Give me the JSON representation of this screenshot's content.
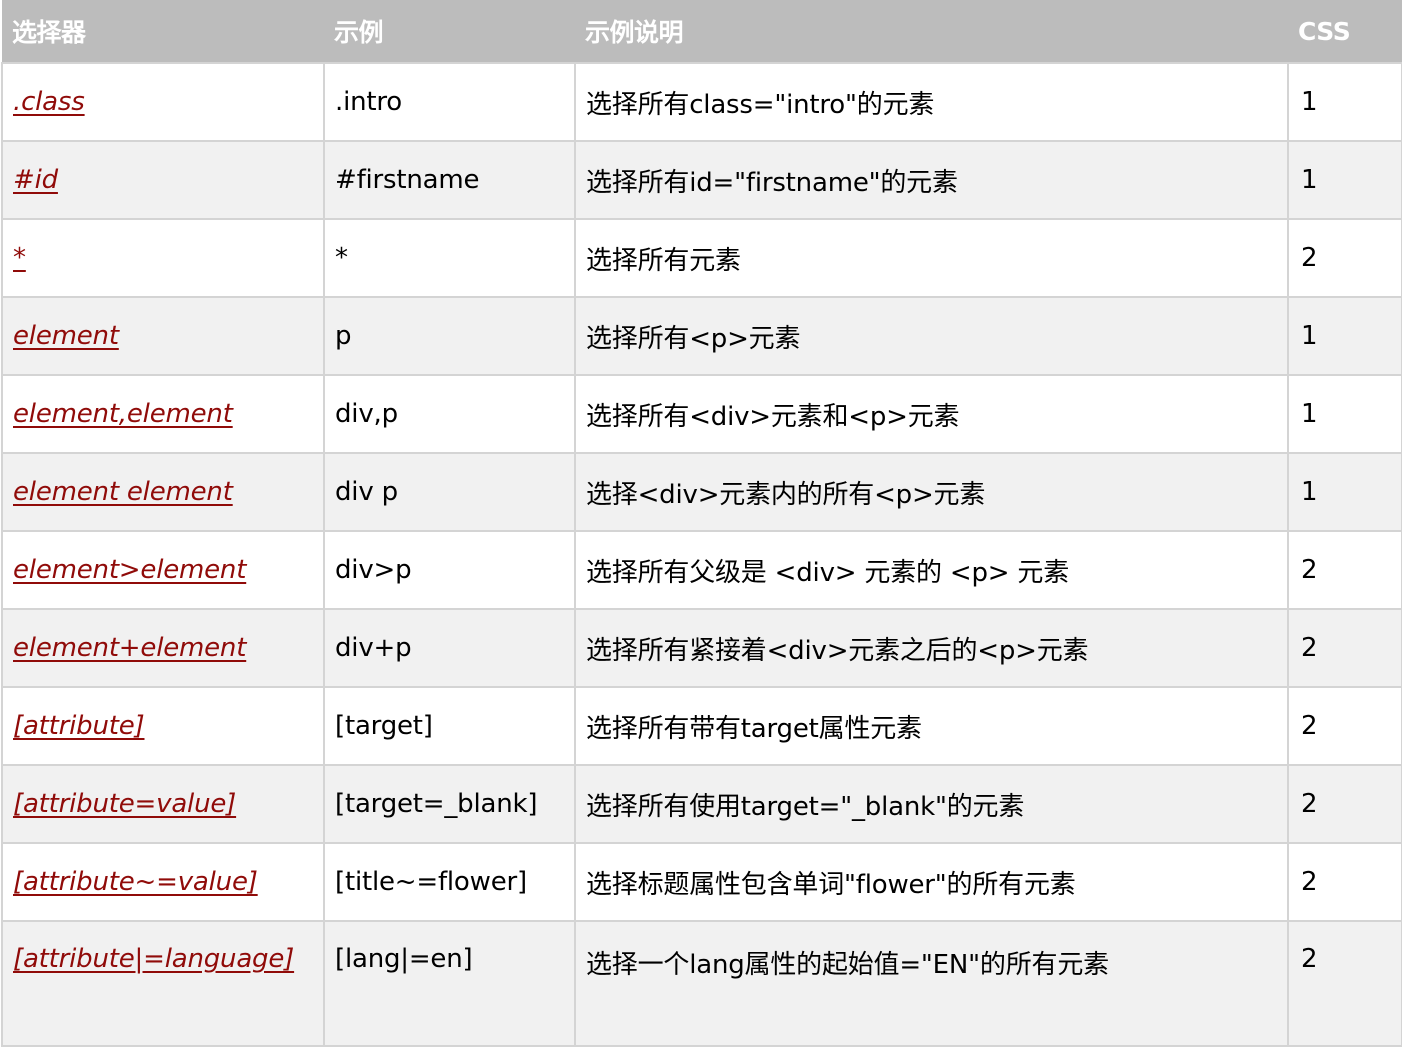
{
  "header": {
    "selector": "选择器",
    "example": "示例",
    "description": "示例说明",
    "css": "CSS"
  },
  "rows": [
    {
      "selector": ".class",
      "example": ".intro",
      "description": "选择所有class=\"intro\"的元素",
      "css": "1"
    },
    {
      "selector": "#id",
      "example": "#firstname",
      "description": "选择所有id=\"firstname\"的元素",
      "css": "1"
    },
    {
      "selector": "*",
      "example": "*",
      "description": "选择所有元素",
      "css": "2"
    },
    {
      "selector": "element",
      "example": "p",
      "description": "选择所有<p>元素",
      "css": "1"
    },
    {
      "selector": "element,element",
      "example": "div,p",
      "description": "选择所有<div>元素和<p>元素",
      "css": "1"
    },
    {
      "selector": "element element",
      "example": "div p",
      "description": "选择<div>元素内的所有<p>元素",
      "css": "1"
    },
    {
      "selector": "element>element",
      "example": "div>p",
      "description": "选择所有父级是 <div> 元素的 <p> 元素",
      "css": "2"
    },
    {
      "selector": "element+element",
      "example": "div+p",
      "description": "选择所有紧接着<div>元素之后的<p>元素",
      "css": "2"
    },
    {
      "selector": "[attribute]",
      "example": "[target]",
      "description": "选择所有带有target属性元素",
      "css": "2"
    },
    {
      "selector": "[attribute=value]",
      "example": "[target=_blank]",
      "description": "选择所有使用target=\"_blank\"的元素",
      "css": "2"
    },
    {
      "selector": "[attribute~=value]",
      "example": "[title~=flower]",
      "description": "选择标题属性包含单词\"flower\"的所有元素",
      "css": "2"
    },
    {
      "selector": "[attribute|=language]",
      "example": "[lang|=en]",
      "description": "选择一个lang属性的起始值=\"EN\"的所有元素",
      "css": "2"
    }
  ]
}
